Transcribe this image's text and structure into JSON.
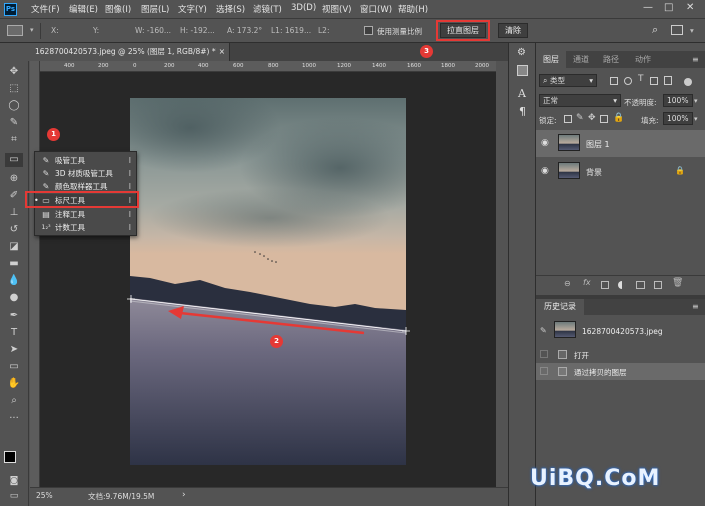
{
  "app": {
    "logo": "Ps"
  },
  "menubar": {
    "items": [
      "文件(F)",
      "编辑(E)",
      "图像(I)",
      "图层(L)",
      "文字(Y)",
      "选择(S)",
      "滤镜(T)",
      "3D(D)",
      "视图(V)",
      "窗口(W)",
      "帮助(H)"
    ],
    "window_controls": {
      "minimize": "—",
      "maximize": "□",
      "close": "✕"
    }
  },
  "options_bar": {
    "x": "X:",
    "y": "Y:",
    "w": "W: -160...",
    "h": "H: -192...",
    "a": "A: 173.2°",
    "l1": "L1: 1619...",
    "l2": "L2:",
    "use_measurement_scale": "使用测量比例",
    "straighten_button": "拉直图层",
    "clear_button": "清除"
  },
  "document": {
    "tab_title": "1628700420573.jpeg @ 25% (图层 1, RGB/8#) *",
    "close": "×",
    "ruler_ticks": [
      "400",
      "200",
      "0",
      "200",
      "400",
      "600",
      "800",
      "1000",
      "1200",
      "1400",
      "1600",
      "1800",
      "2000"
    ]
  },
  "flyout": {
    "items": [
      {
        "label": "吸管工具",
        "key": "I",
        "icon": "eyedropper-icon"
      },
      {
        "label": "3D 材质吸管工具",
        "key": "I",
        "icon": "3d-eyedropper-icon"
      },
      {
        "label": "颜色取样器工具",
        "key": "I",
        "icon": "color-sampler-icon"
      },
      {
        "label": "标尺工具",
        "key": "I",
        "icon": "ruler-icon",
        "selected": true
      },
      {
        "label": "注释工具",
        "key": "I",
        "icon": "note-icon"
      },
      {
        "label": "计数工具",
        "key": "I",
        "icon": "count-icon"
      }
    ]
  },
  "annotations": {
    "badge1": "1",
    "badge2": "2",
    "badge3": "3"
  },
  "status": {
    "zoom": "25%",
    "doc_size": "文档:9.76M/19.5M",
    "arrow": "›"
  },
  "layers_panel": {
    "tabs": [
      "图层",
      "通道",
      "路径",
      "动作"
    ],
    "filter_kind": "类型",
    "blend_mode": "正常",
    "opacity_label": "不透明度:",
    "opacity_value": "100%",
    "lock_label": "锁定:",
    "fill_label": "填充:",
    "fill_value": "100%",
    "layers": [
      {
        "name": "图层 1",
        "selected": true
      },
      {
        "name": "背景",
        "locked": true
      }
    ]
  },
  "history_panel": {
    "title": "历史记录",
    "snapshot": "1628700420573.jpeg",
    "states": [
      "打开",
      "通过拷贝的图层"
    ]
  },
  "watermark": {
    "text": "UiBQ.CoM",
    "sub": "UiBQ.CoM"
  },
  "colors": {
    "accent_red": "#e53935",
    "ui_bg": "#535353",
    "panel_dark": "#3f3f3f"
  }
}
